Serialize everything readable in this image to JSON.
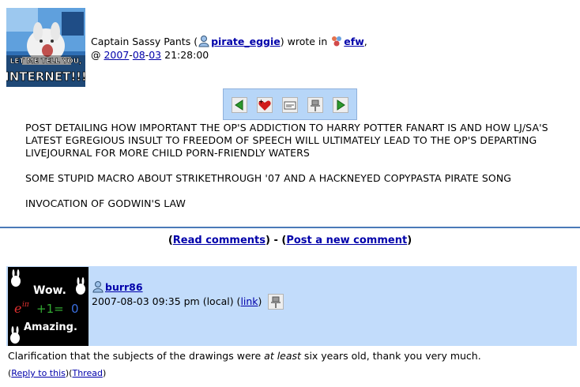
{
  "entry": {
    "userpic_text": [
      "LET ME TELL YOU,",
      "INTERNET!!!"
    ],
    "poster_name": "Captain Sassy Pants",
    "open_paren": " (",
    "username": "pirate_eggie",
    "wrote_in": ") wrote in ",
    "community": "efw",
    "comma": ",",
    "at": "@ ",
    "date_year": "2007",
    "date_month": "08",
    "date_day": "03",
    "dash": "-",
    "time": " 21:28:00"
  },
  "toolbar": {
    "buttons": [
      "previous-entry",
      "add-to-memories",
      "tell-a-friend",
      "track-this",
      "next-entry"
    ]
  },
  "post": {
    "paragraphs": [
      "POST DETAILING HOW IMPORTANT THE OP'S ADDICTION TO HARRY POTTER FANART IS AND HOW LJ/SA'S LATEST EGREGIOUS INSULT TO FREEDOM OF SPEECH WILL ULTIMATELY LEAD TO THE OP'S DEPARTING LIVEJOURNAL FOR MORE CHILD PORN-FRIENDLY WATERS",
      "SOME STUPID MACRO ABOUT STRIKETHROUGH '07 AND A HACKNEYED COPYPASTA PIRATE SONG",
      "INVOCATION OF GODWIN'S LAW"
    ]
  },
  "comment_links": {
    "open": "(",
    "read": "Read comments",
    "mid": ") - (",
    "post": "Post a new comment",
    "close": ")"
  },
  "comment": {
    "userpic_text": [
      "Wow.",
      "Amazing."
    ],
    "userpic_formula": [
      "e",
      "iπ",
      "+1=",
      "0"
    ],
    "username": "burr86",
    "date": "2007-08-03 09:35 pm (local) (",
    "link": "link",
    "date_close": ")",
    "text_before": "Clarification that the subjects of the drawings were ",
    "text_em": "at least",
    "text_after": " six years old, thank you very much.",
    "reply": "Reply to this",
    "thread": "Thread",
    "paren_open": "(",
    "paren_mid": ")(",
    "paren_close": ")"
  },
  "colors": {
    "link": "#0000aa",
    "toolbar_bg": "#b7d6f8",
    "comment_bg": "#c2dcfb",
    "separator": "#4a7ab8"
  }
}
